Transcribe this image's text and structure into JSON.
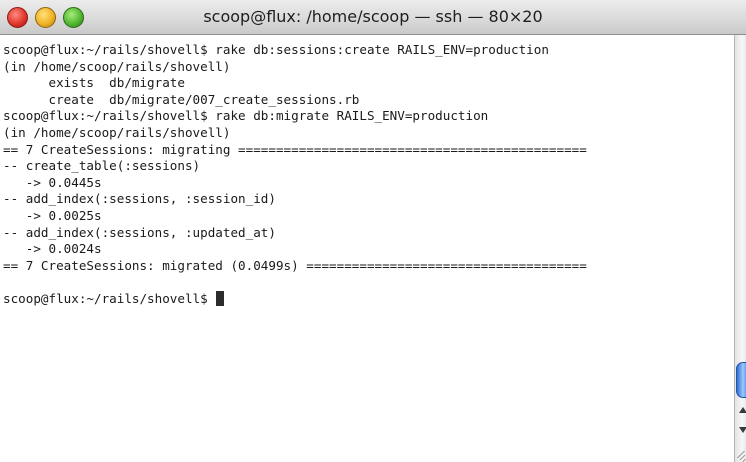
{
  "window": {
    "title": "scoop@flux: /home/scoop — ssh — 80×20"
  },
  "terminal": {
    "lines": [
      "scoop@flux:~/rails/shovell$ rake db:sessions:create RAILS_ENV=production",
      "(in /home/scoop/rails/shovell)",
      "      exists  db/migrate",
      "      create  db/migrate/007_create_sessions.rb",
      "scoop@flux:~/rails/shovell$ rake db:migrate RAILS_ENV=production",
      "(in /home/scoop/rails/shovell)",
      "== 7 CreateSessions: migrating ==============================================",
      "-- create_table(:sessions)",
      "   -> 0.0445s",
      "-- add_index(:sessions, :session_id)",
      "   -> 0.0025s",
      "-- add_index(:sessions, :updated_at)",
      "   -> 0.0024s",
      "== 7 CreateSessions: migrated (0.0499s) =====================================",
      "",
      "scoop@flux:~/rails/shovell$ "
    ]
  }
}
